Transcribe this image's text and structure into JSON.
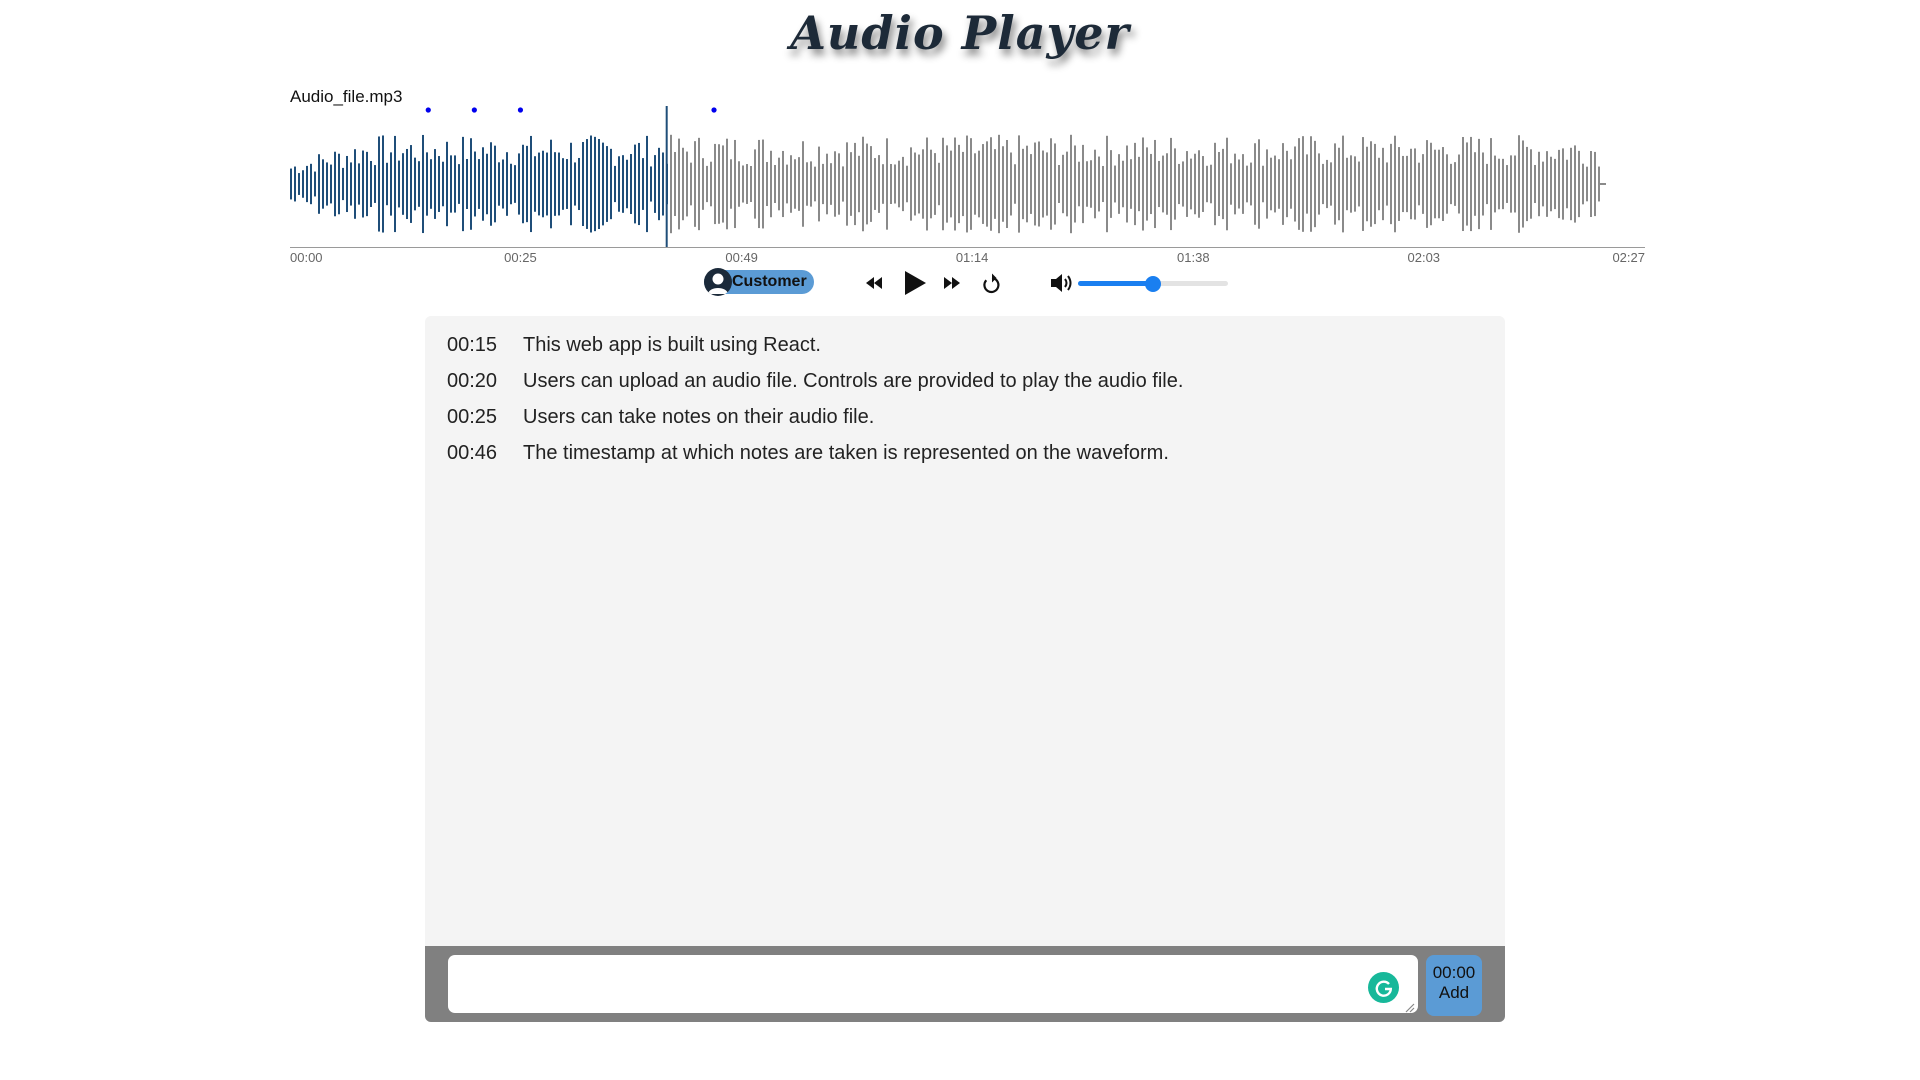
{
  "app": {
    "title": "Audio Player"
  },
  "file": {
    "name": "Audio_file.mp3"
  },
  "timeline": {
    "ticks": [
      "00:00",
      "00:25",
      "00:49",
      "01:14",
      "01:38",
      "02:03",
      "02:27"
    ],
    "progress_fraction": 0.278,
    "note_markers": [
      "00:15",
      "00:20",
      "00:25",
      "00:46"
    ],
    "played_color": "#1f4e79",
    "unplayed_color": "#8a8a8a",
    "marker_color": "#0000ee"
  },
  "controls": {
    "speaker_label": "Customer",
    "speaker_icon": "user-avatar-icon",
    "rewind_icon": "rewind-icon",
    "play_icon": "play-icon",
    "forward_icon": "fast-forward-icon",
    "restart_icon": "restart-icon",
    "volume_icon": "volume-icon",
    "volume_fraction": 0.5,
    "accent": "#1a7ff0",
    "badge_color": "#5b9bd5"
  },
  "notes": [
    {
      "time": "00:15",
      "text": "This web app is built using React."
    },
    {
      "time": "00:20",
      "text": "Users can upload an audio file. Controls are provided to play the audio file."
    },
    {
      "time": "00:25",
      "text": "Users can take notes on their audio file."
    },
    {
      "time": "00:46",
      "text": "The timestamp at which notes are taken is represented on the waveform."
    }
  ],
  "composer": {
    "input_value": "",
    "assistant_icon": "grammarly-icon",
    "add_time": "00:00",
    "add_label": "Add"
  }
}
